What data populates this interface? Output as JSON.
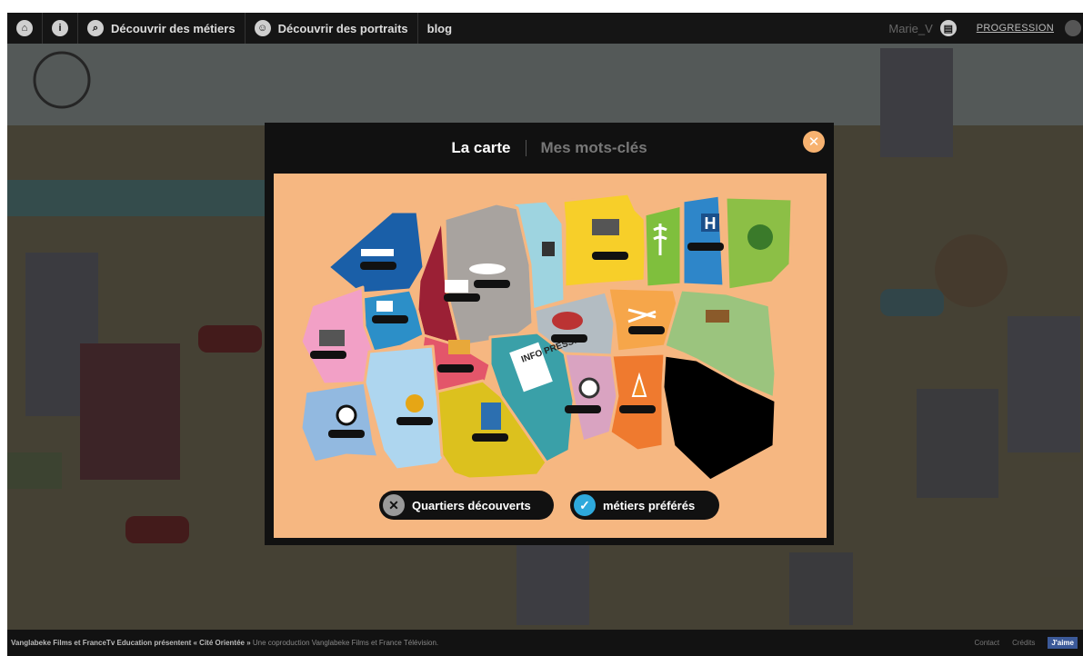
{
  "nav": {
    "home_icon": "home-icon",
    "info_icon": "info-icon",
    "discover_jobs": "Découvrir des métiers",
    "discover_portraits": "Découvrir des portraits",
    "blog": "blog",
    "user": "Marie_V",
    "progression": "PROGRESSION"
  },
  "modal": {
    "tabs": [
      "La carte",
      "Mes mots-clés"
    ],
    "close_icon": "close-icon",
    "districts": [
      {
        "name": "ship",
        "color": "#1a5fa8",
        "stars": 5
      },
      {
        "name": "factory",
        "color": "#9b2035",
        "stars": 5
      },
      {
        "name": "plane",
        "color": "#a8a39f",
        "stars": 5
      },
      {
        "name": "camera",
        "color": "#9ed4e0",
        "stars": 0
      },
      {
        "name": "paint",
        "color": "#f7cf29",
        "stars": 5
      },
      {
        "name": "caduceus",
        "color": "#7fbf3d",
        "stars": 0
      },
      {
        "name": "hospital",
        "color": "#2e86c9",
        "stars": 5
      },
      {
        "name": "plant",
        "color": "#8cbf46",
        "stars": 0
      },
      {
        "name": "police",
        "color": "#2c8fc8",
        "stars": 5
      },
      {
        "name": "typewriter",
        "color": "#f2a0c6",
        "stars": 5
      },
      {
        "name": "theater",
        "color": "#e3566a",
        "stars": 5
      },
      {
        "name": "meat",
        "color": "#b3bcc2",
        "stars": 5
      },
      {
        "name": "scissors",
        "color": "#f6a64a",
        "stars": 5
      },
      {
        "name": "stump",
        "color": "#9bc47e",
        "stars": 0
      },
      {
        "name": "info-press",
        "color": "#3aa0a8",
        "stars": 0
      },
      {
        "name": "coin",
        "color": "#aed6ef",
        "stars": 5
      },
      {
        "name": "football",
        "color": "#92b9e0",
        "stars": 5
      },
      {
        "name": "gas-pump",
        "color": "#dcc11e",
        "stars": 5
      },
      {
        "name": "disc",
        "color": "#d9a3c1",
        "stars": 5
      },
      {
        "name": "cone",
        "color": "#ef7a2f",
        "stars": 5
      },
      {
        "name": "locked",
        "color": "#000000",
        "stars": 0
      }
    ],
    "info_press_label": "INFO PRESSE",
    "hospital_label": "H",
    "buttons": {
      "discovered": "Quartiers découverts",
      "favorites": "métiers préférés"
    }
  },
  "footer": {
    "credit_bold": "Vanglabeke Films et FranceTv Education présentent « Cité Orientée »",
    "credit_rest": " Une coproduction Vanglabeke Films et France Télévision.",
    "contact": "Contact",
    "credits": "Crédits",
    "like": "J'aime"
  }
}
